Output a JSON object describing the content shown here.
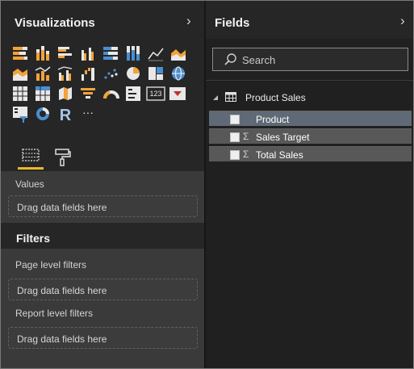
{
  "visualizations": {
    "title": "Visualizations",
    "chevron": "›"
  },
  "viz_icons": [
    "stacked-bar-icon",
    "stacked-column-icon",
    "clustered-bar-icon",
    "clustered-column-icon",
    "100pct-bar-icon",
    "100pct-column-icon",
    "line-chart-icon",
    "area-chart-icon",
    "stacked-area-icon",
    "line-column-icon",
    "line-clustered-column-icon",
    "waterfall-icon",
    "scatter-icon",
    "pie-chart-icon",
    "treemap-icon",
    "map-icon",
    "table-icon",
    "matrix-icon",
    "filled-map-icon",
    "funnel-icon",
    "gauge-icon",
    "multirow-card-icon",
    "card-icon",
    "kpi-icon",
    "slicer-icon",
    "donut-icon",
    "r-visual-icon",
    "more-visuals-icon"
  ],
  "r_glyph": "R",
  "more_glyph": "···",
  "values_section": {
    "label": "Values",
    "dropzone": "Drag data fields here"
  },
  "filters": {
    "title": "Filters",
    "page_label": "Page level filters",
    "page_dropzone": "Drag data fields here",
    "report_label": "Report level filters",
    "report_dropzone": "Drag data fields here"
  },
  "fields": {
    "title": "Fields",
    "chevron": "›",
    "search_placeholder": "Search",
    "table_name": "Product Sales",
    "items": [
      {
        "name": "Product",
        "sigma": ""
      },
      {
        "name": "Sales Target",
        "sigma": "Σ"
      },
      {
        "name": "Total Sales",
        "sigma": "Σ"
      }
    ]
  },
  "colors": {
    "accent": "#e8b929",
    "chart_orange": "#f2a33a",
    "chart_blue": "#4a8fd0",
    "chart_white": "#e8e8e8"
  }
}
